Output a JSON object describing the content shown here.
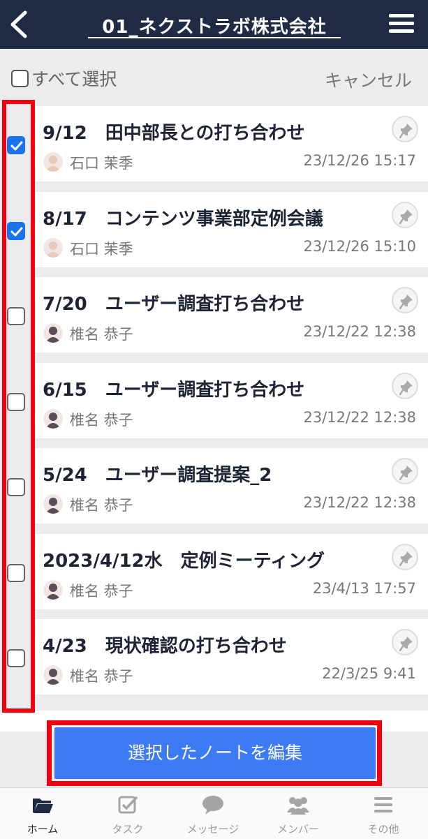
{
  "header": {
    "title": "01_ネクストラボ株式会社",
    "back_icon": "chevron-left-icon",
    "menu_icon": "hamburger-menu-icon"
  },
  "select_bar": {
    "select_all_label": "すべて選択",
    "cancel_label": "キャンセル"
  },
  "notes": [
    {
      "title": "9/12　田中部長との打ち合わせ",
      "author": "石口 茉季",
      "date": "23/12/26 15:17",
      "checked": true
    },
    {
      "title": "8/17　コンテンツ事業部定例会議",
      "author": "石口 茉季",
      "date": "23/12/26 15:10",
      "checked": true
    },
    {
      "title": "7/20　ユーザー調査打ち合わせ",
      "author": "椎名 恭子",
      "date": "23/12/22 12:38",
      "checked": false
    },
    {
      "title": "6/15　ユーザー調査打ち合わせ",
      "author": "椎名 恭子",
      "date": "23/12/22 12:38",
      "checked": false
    },
    {
      "title": "5/24　ユーザー調査提案_2",
      "author": "椎名 恭子",
      "date": "23/12/22 12:38",
      "checked": false
    },
    {
      "title": "2023/4/12水　定例ミーティング",
      "author": "椎名 恭子",
      "date": "23/4/13 17:57",
      "checked": false
    },
    {
      "title": "4/23　現状確認の打ち合わせ",
      "author": "椎名 恭子",
      "date": "22/3/25 9:41",
      "checked": false
    }
  ],
  "edit_button": {
    "label": "選択したノートを編集"
  },
  "tabbar": {
    "tabs": [
      {
        "label": "ホーム",
        "icon": "folder-icon",
        "active": true
      },
      {
        "label": "タスク",
        "icon": "checkbox-task-icon",
        "active": false
      },
      {
        "label": "メッセージ",
        "icon": "chat-bubble-icon",
        "active": false
      },
      {
        "label": "メンバー",
        "icon": "members-group-icon",
        "active": false
      },
      {
        "label": "その他",
        "icon": "more-menu-icon",
        "active": false
      }
    ]
  },
  "colors": {
    "header_bg": "#1f2a44",
    "accent_blue": "#3d7af5",
    "checkbox_blue": "#1a73e8",
    "highlight_red": "#f2000f"
  }
}
